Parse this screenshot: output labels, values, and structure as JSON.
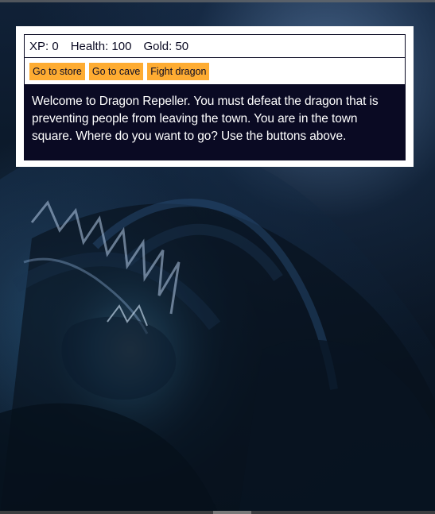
{
  "stats": {
    "xp_label": "XP:",
    "xp_value": "0",
    "health_label": "Health:",
    "health_value": "100",
    "gold_label": "Gold:",
    "gold_value": "50"
  },
  "controls": {
    "button1_label": "Go to store",
    "button2_label": "Go to cave",
    "button3_label": "Fight dragon"
  },
  "text": {
    "message": "Welcome to Dragon Repeller. You must defeat the dragon that is preventing people from leaving the town. You are in the town square. Where do you want to go? Use the buttons above."
  },
  "colors": {
    "panel_bg": "#ffffff",
    "panel_dark": "#0a0a23",
    "button": "#feac32",
    "text": "#ffffff"
  }
}
